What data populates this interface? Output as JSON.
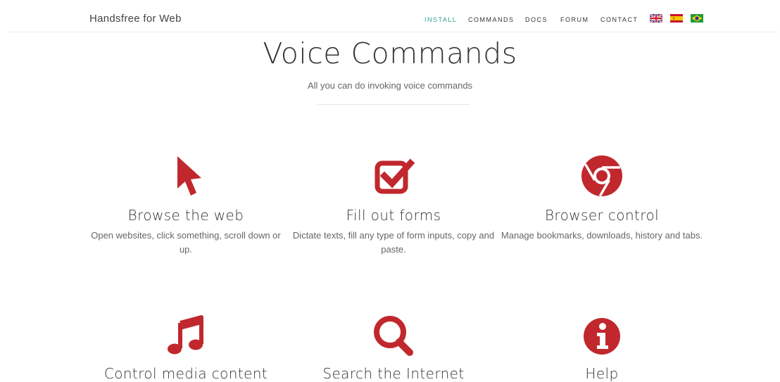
{
  "brand": "Handsfree for Web",
  "nav": {
    "items": [
      {
        "label": "INSTALL",
        "active": true
      },
      {
        "label": "COMMANDS",
        "active": false
      },
      {
        "label": "DOCS",
        "active": false
      },
      {
        "label": "FORUM",
        "active": false
      },
      {
        "label": "CONTACT",
        "active": false
      }
    ],
    "active_color": "#2aa18e",
    "flags": [
      "uk-flag-icon",
      "spain-flag-icon",
      "brazil-flag-icon"
    ]
  },
  "hero": {
    "title": "Voice Commands",
    "subtitle": "All you can do invoking voice commands"
  },
  "accent_color": "#c0282d",
  "features": [
    {
      "icon": "pointer-icon",
      "title": "Browse the web",
      "description": "Open websites, click something, scroll down or up."
    },
    {
      "icon": "check-square-icon",
      "title": "Fill out forms",
      "description": "Dictate texts, fill any type of form inputs, copy and paste."
    },
    {
      "icon": "chrome-icon",
      "title": "Browser control",
      "description": "Manage bookmarks, downloads, history and tabs."
    },
    {
      "icon": "music-icon",
      "title": "Control media content",
      "description": ""
    },
    {
      "icon": "search-icon",
      "title": "Search the Internet",
      "description": ""
    },
    {
      "icon": "info-icon",
      "title": "Help",
      "description": ""
    }
  ]
}
